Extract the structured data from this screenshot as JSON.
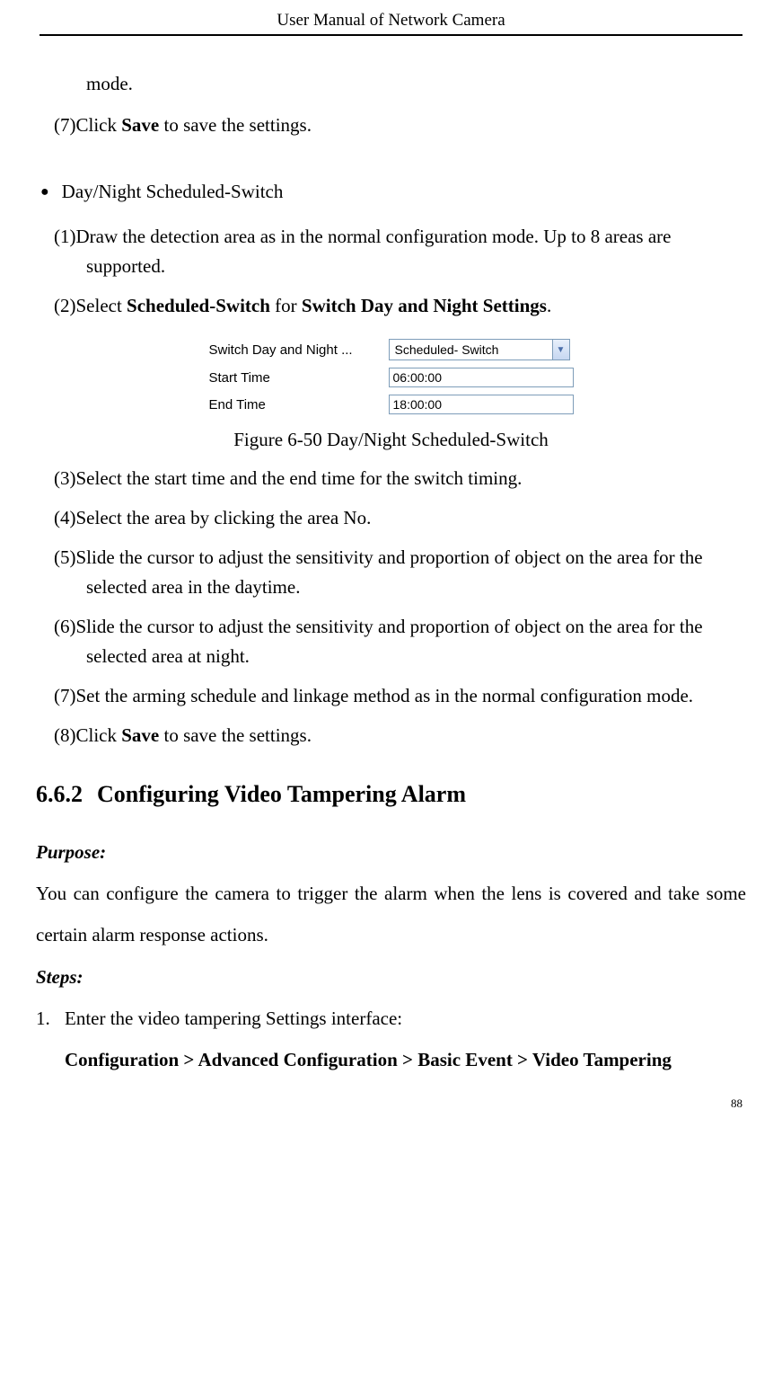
{
  "header": {
    "title": "User Manual of Network Camera"
  },
  "top": {
    "mode_line": "mode.",
    "step7_prefix": "(7)Click ",
    "step7_bold": "Save",
    "step7_suffix": " to save the settings."
  },
  "bullet": {
    "title": "Day/Night Scheduled-Switch"
  },
  "steps_a": {
    "s1": "(1)Draw the detection area as in the normal configuration mode. Up to 8 areas are supported.",
    "s2_prefix": "(2)Select ",
    "s2_b1": "Scheduled-Switch",
    "s2_mid": " for ",
    "s2_b2": "Switch Day and Night Settings",
    "s2_suffix": "."
  },
  "figure": {
    "labels": {
      "switch": "Switch Day and Night ...",
      "start": "Start Time",
      "end": "End Time"
    },
    "values": {
      "select": "Scheduled- Switch",
      "start": "06:00:00",
      "end": "18:00:00"
    },
    "caption": "Figure 6-50 Day/Night Scheduled-Switch"
  },
  "steps_b": {
    "s3": "(3)Select the start time and the end time for the switch timing.",
    "s4": "(4)Select the area by clicking the area No.",
    "s5": "(5)Slide the cursor to adjust the sensitivity and proportion of object on the area for the selected area in the daytime.",
    "s6": "(6)Slide the cursor to adjust the sensitivity and proportion of object on the area for the selected area at night.",
    "s7": "(7)Set the arming schedule and linkage method as in the normal configuration mode.",
    "s8_prefix": "(8)Click ",
    "s8_bold": "Save",
    "s8_suffix": " to save the settings."
  },
  "section": {
    "num": "6.6.2",
    "title": "Configuring Video Tampering Alarm"
  },
  "purpose": {
    "label": "Purpose:",
    "text": "You can configure the camera to trigger the alarm when the lens is covered and take some certain alarm response actions."
  },
  "steps_label": "Steps:",
  "num_steps": {
    "s1_num": "1.",
    "s1_text": "Enter the video tampering Settings interface:",
    "path": "Configuration > Advanced Configuration > Basic Event > Video Tampering"
  },
  "page_number": "88"
}
